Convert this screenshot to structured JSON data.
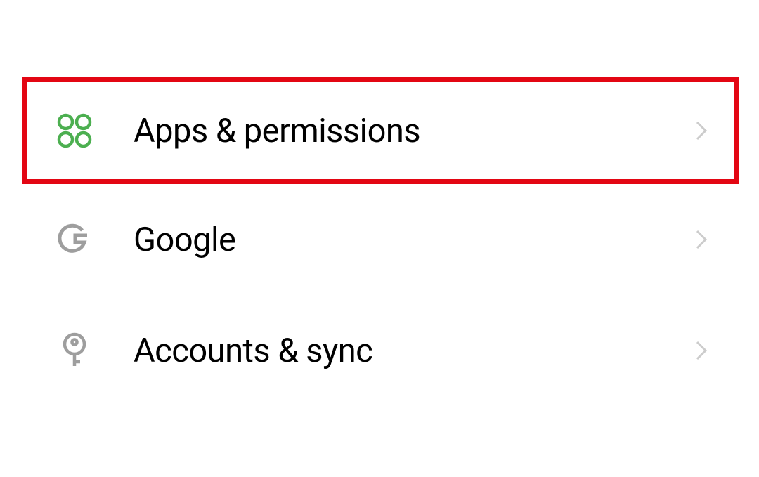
{
  "settings": {
    "items": [
      {
        "label": "Apps & permissions",
        "icon": "apps-icon",
        "highlighted": true
      },
      {
        "label": "Google",
        "icon": "google-icon",
        "highlighted": false
      },
      {
        "label": "Accounts & sync",
        "icon": "key-icon",
        "highlighted": false
      }
    ]
  },
  "colors": {
    "apps_icon": "#4caf50",
    "google_icon": "#9e9e9e",
    "key_icon": "#9e9e9e",
    "chevron": "#cccccc",
    "highlight_border": "#e30613"
  }
}
